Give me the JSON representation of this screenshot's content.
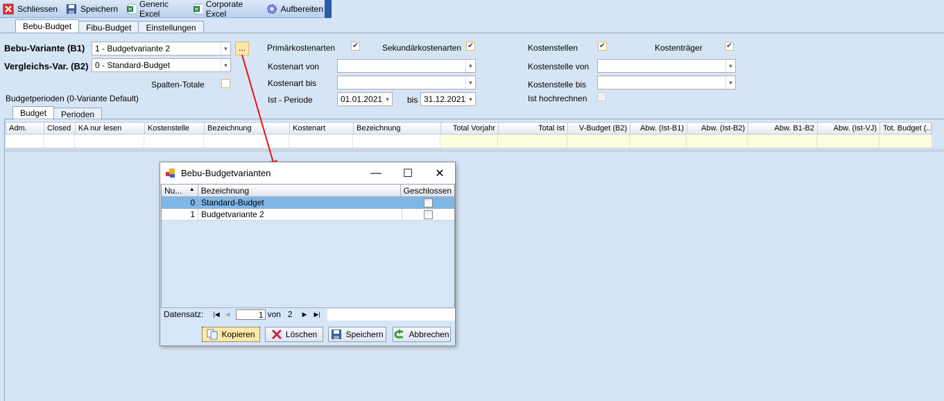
{
  "toolbar": {
    "items": [
      {
        "label": "Schliessen",
        "icon": "close-icon"
      },
      {
        "label": "Speichern",
        "icon": "save-icon"
      },
      {
        "label": "Generic Excel",
        "icon": "excel-icon"
      },
      {
        "label": "Corporate Excel",
        "icon": "excel-icon"
      },
      {
        "label": "Aufbereiten",
        "icon": "gear-icon"
      }
    ]
  },
  "tabs": [
    "Bebu-Budget",
    "Fibu-Budget",
    "Einstellungen"
  ],
  "form": {
    "variante_label": "Bebu-Variante (B1)",
    "variante_value": "1 - Budgetvariante 2",
    "ellipsis": "...",
    "vergleich_label": "Vergleichs-Var. (B2)",
    "vergleich_value": "0 - Standard-Budget",
    "spalten_totale": "Spalten-Totale",
    "spalten_totale_checked": false,
    "budgetperioden": "Budgetperioden (0-Variante Default)",
    "primaer": "Primärkostenarten",
    "primaer_checked": true,
    "sekundaer": "Sekundärkostenarten",
    "sekundaer_checked": true,
    "kostenstellen": "Kostenstellen",
    "kostenstellen_checked": true,
    "kostentraeger": "Kostenträger",
    "kostentraeger_checked": true,
    "kostenart_von": "Kostenart von",
    "kostenart_von_value": "",
    "kostenart_bis": "Kostenart bis",
    "kostenart_bis_value": "",
    "ist_periode": "Ist - Periode",
    "periode_von": "01.01.2021",
    "bis": "bis",
    "periode_bis": "31.12.2021",
    "kostenstelle_von": "Kostenstelle von",
    "kostenstelle_von_value": "",
    "kostenstelle_bis": "Kostenstelle bis",
    "kostenstelle_bis_value": "",
    "ist_hochrechnen": "Ist hochrechnen",
    "ist_hochrechnen_checked": false
  },
  "subtabs": [
    "Budget",
    "Perioden"
  ],
  "grid": {
    "columns": [
      "Adm.",
      "Closed",
      "KA nur lesen",
      "Kostenstelle",
      "Bezeichnung",
      "Kostenart",
      "Bezeichnung",
      "Total Vorjahr",
      "Total Ist",
      "V-Budget (B2)",
      "Abw. (Ist-B1)",
      "Abw. (Ist-B2)",
      "Abw. B1-B2",
      "Abw. (Ist-VJ)",
      "Tot. Budget (..."
    ]
  },
  "dialog": {
    "title": "Bebu-Budgetvarianten",
    "columns": [
      "Nu...",
      "Bezeichnung",
      "Geschlossen"
    ],
    "rows": [
      {
        "nr": "0",
        "bezeichnung": "Standard-Budget",
        "geschlossen": false,
        "selected": true
      },
      {
        "nr": "1",
        "bezeichnung": "Budgetvariante 2",
        "geschlossen": false,
        "selected": false
      }
    ],
    "navigator": {
      "label": "Datensatz:",
      "current": "1",
      "von": "von",
      "total": "2"
    },
    "buttons": [
      "Kopieren",
      "Löschen",
      "Speichern",
      "Abbrechen"
    ]
  },
  "colors": {
    "accent_arrow": "#e81010",
    "selection": "#7fb6e8",
    "background": "#d6e5f5"
  }
}
